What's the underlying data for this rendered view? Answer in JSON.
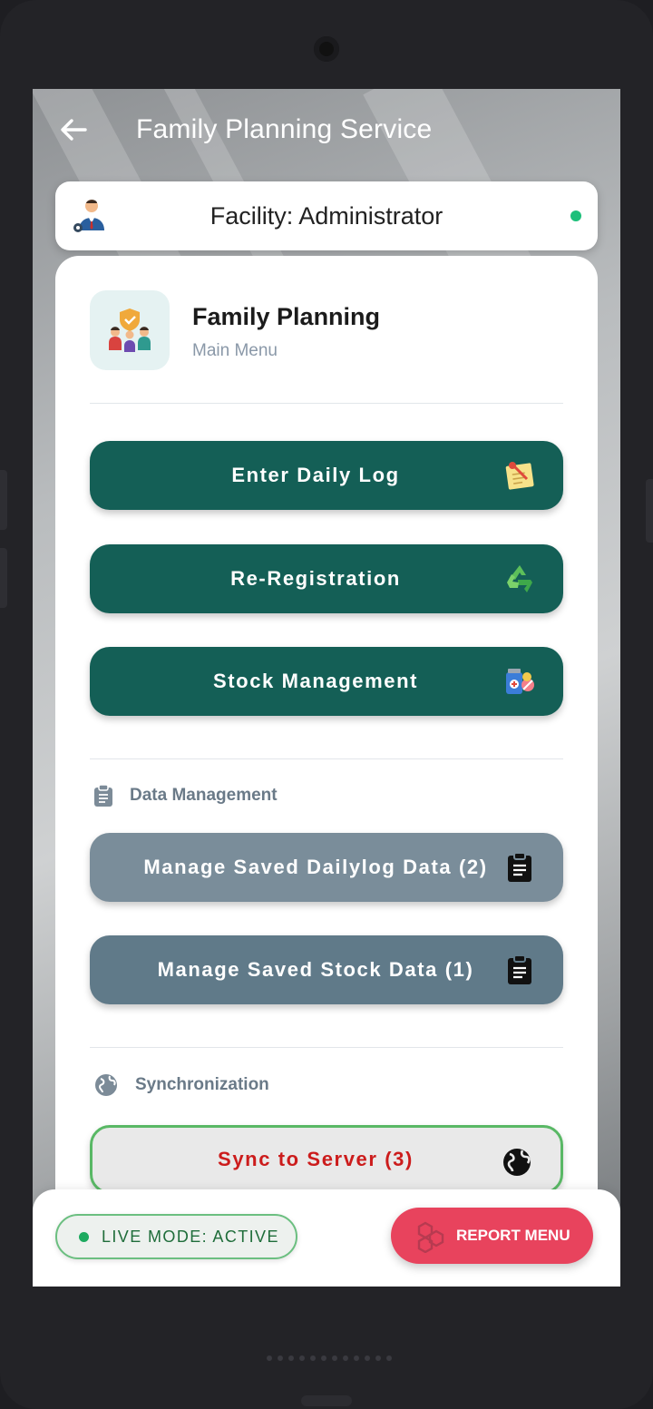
{
  "appbar": {
    "title": "Family Planning Service"
  },
  "facility": {
    "label": "Facility: Administrator",
    "status_color": "#1dbf7a"
  },
  "module": {
    "title": "Family Planning",
    "subtitle": "Main Menu"
  },
  "primary_actions": [
    {
      "label": "Enter Daily Log",
      "icon": "notepad-icon"
    },
    {
      "label": "Re-Registration",
      "icon": "recycle-icon"
    },
    {
      "label": "Stock Management",
      "icon": "medicine-icon"
    }
  ],
  "data_management": {
    "heading": "Data Management",
    "buttons": [
      {
        "label": "Manage Saved Dailylog Data (2)",
        "icon": "clipboard-icon"
      },
      {
        "label": "Manage Saved Stock Data (1)",
        "icon": "clipboard-icon"
      }
    ]
  },
  "synchronization": {
    "heading": "Synchronization",
    "sync_label": "Sync to Server (3)",
    "icon": "globe-icon"
  },
  "bottom_bar": {
    "live_mode": "LIVE MODE: ACTIVE",
    "report_menu": "REPORT MENU"
  },
  "colors": {
    "primary": "#145f56",
    "slate_light": "#7a8d9a",
    "slate_dark": "#607a89",
    "sync_text": "#cc1c1c",
    "report": "#e8435d"
  }
}
